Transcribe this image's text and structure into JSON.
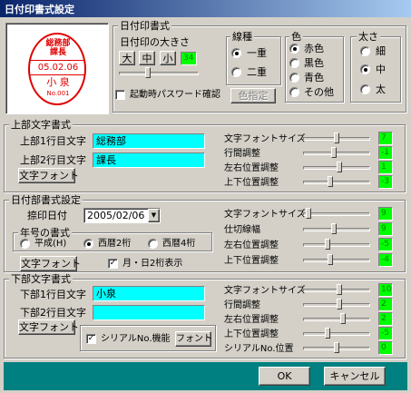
{
  "window": {
    "title": "日付印書式設定"
  },
  "stamp": {
    "line1": "総務部",
    "line2": "課長",
    "date": "05.02.06",
    "name": "小 泉",
    "serial": "No.001"
  },
  "date_format": {
    "group": "日付印書式",
    "size_label": "日付印の大きさ",
    "size_buttons": [
      "大",
      "中",
      "小"
    ],
    "size_value": "34",
    "size_slider": 0.35,
    "startup_pw_label": "起動時パスワード確認",
    "startup_pw_checked": false
  },
  "line_type": {
    "group": "線種",
    "options": [
      "一重",
      "二重"
    ],
    "selected": "一重",
    "color_button": "色指定"
  },
  "color": {
    "group": "色",
    "options": [
      "赤色",
      "黒色",
      "青色",
      "その他"
    ],
    "selected": "赤色"
  },
  "thickness": {
    "group": "太さ",
    "options": [
      "細",
      "中",
      "太"
    ],
    "selected": "中"
  },
  "top_text": {
    "group": "上部文字書式",
    "line1_label": "上部1行目文字",
    "line1_value": "総務部",
    "line2_label": "上部2行目文字",
    "line2_value": "課長",
    "font_button": "文字フォント",
    "params": [
      {
        "label": "文字フォントサイズ",
        "value": "7",
        "slider": 0.5
      },
      {
        "label": "行間調整",
        "value": "-1",
        "slider": 0.45
      },
      {
        "label": "左右位置調整",
        "value": "1",
        "slider": 0.55
      },
      {
        "label": "上下位置調整",
        "value": "-3",
        "slider": 0.4
      }
    ]
  },
  "date_part": {
    "group": "日付部書式設定",
    "stamp_date_label": "捺印日付",
    "stamp_date_value": "2005/02/06",
    "year_group": "年号の書式",
    "year_options": [
      "平成(H)",
      "西暦2桁",
      "西暦4桁"
    ],
    "year_selected": "西暦2桁",
    "font_button": "文字フォント",
    "md2_label": "月・日2桁表示",
    "md2_checked": true,
    "params": [
      {
        "label": "文字フォントサイズ",
        "value": "9",
        "slider": 0.05
      },
      {
        "label": "仕切線幅",
        "value": "9",
        "slider": 0.45
      },
      {
        "label": "左右位置調整",
        "value": "-5",
        "slider": 0.35
      },
      {
        "label": "上下位置調整",
        "value": "-4",
        "slider": 0.4
      }
    ]
  },
  "bottom_text": {
    "group": "下部文字書式",
    "line1_label": "下部1行目文字",
    "line1_value": "小泉",
    "line2_label": "下部2行目文字",
    "line2_value": "",
    "font_button": "文字フォント",
    "serial_label": "シリアルNo.機能",
    "serial_checked": true,
    "serial_font_button": "フォント",
    "params": [
      {
        "label": "文字フォントサイズ",
        "value": "10",
        "slider": 0.55
      },
      {
        "label": "行間調整",
        "value": "2",
        "slider": 0.55
      },
      {
        "label": "左右位置調整",
        "value": "2",
        "slider": 0.6
      },
      {
        "label": "上下位置調整",
        "value": "-5",
        "slider": 0.35
      },
      {
        "label": "シリアルNo.位置",
        "value": "0",
        "slider": 0.5
      }
    ]
  },
  "footer": {
    "ok": "OK",
    "cancel": "キャンセル"
  },
  "colors": {
    "accent_cyan": "#00ffff",
    "value_green": "#00ff00",
    "footer_teal": "#008080",
    "stamp_red": "#e00000"
  }
}
